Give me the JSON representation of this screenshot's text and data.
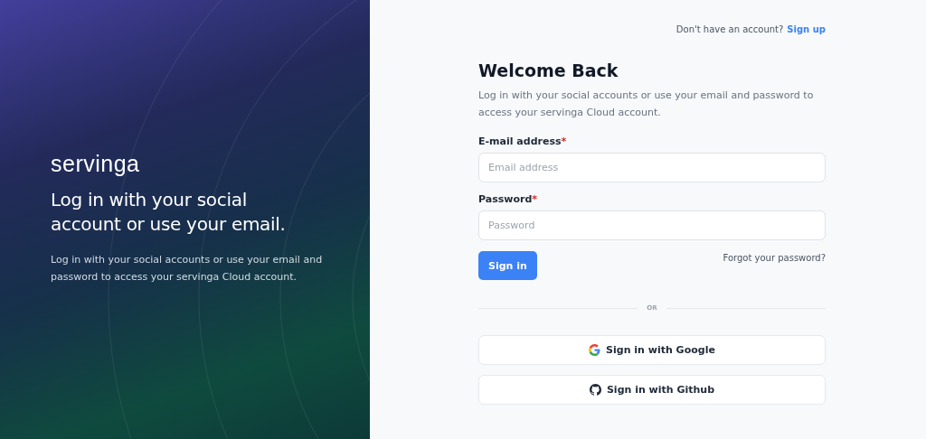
{
  "hero": {
    "logo": "servinga",
    "headline": "Log in with your social account or use your email.",
    "text": "Log in with your social accounts or use your email and password to access your servinga Cloud account."
  },
  "signup": {
    "prompt": "Don't have an account?",
    "link": "Sign up"
  },
  "form": {
    "title": "Welcome Back",
    "subtitle": "Log in with your social accounts or use your email and password to access your servinga Cloud account.",
    "fields": [
      {
        "label": "E-mail address",
        "required_mark": "*",
        "placeholder": "Email address"
      },
      {
        "label": "Password",
        "required_mark": "*",
        "placeholder": "Password"
      }
    ],
    "submit": "Sign in",
    "forgot": "Forgot your password?",
    "divider": "OR",
    "social": [
      {
        "kind": "google",
        "label": "Sign in with Google"
      },
      {
        "kind": "github",
        "label": "Sign in with Github"
      }
    ]
  }
}
